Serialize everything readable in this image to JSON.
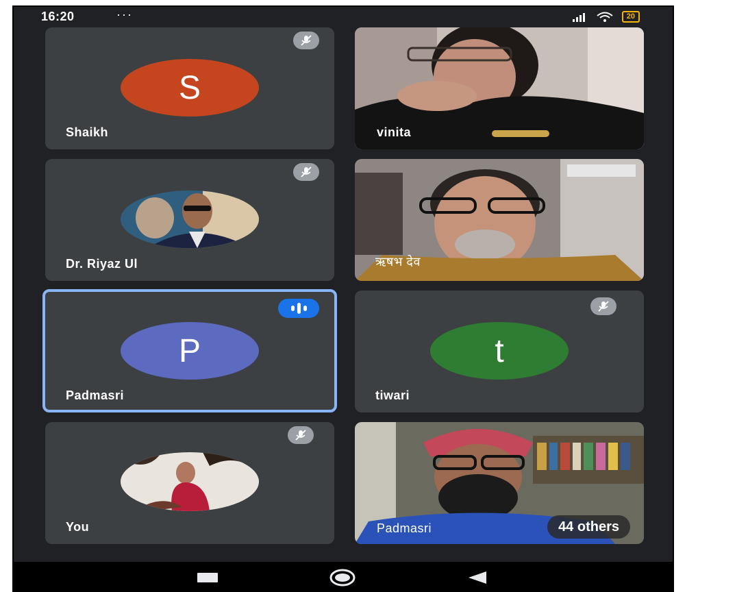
{
  "status_bar": {
    "time": "16:20",
    "more": "···",
    "signal": "signal-icon",
    "wifi": "wifi-icon",
    "battery": "20"
  },
  "tiles": [
    {
      "name": "Shaikh",
      "initial": "S",
      "color": "#c5451f",
      "muted": true
    },
    {
      "name": "vinita",
      "type": "video",
      "muted": false
    },
    {
      "name": "Dr. Riyaz Ul",
      "type": "photo-avatar",
      "muted": true
    },
    {
      "name": "ऋषभ देव",
      "type": "video",
      "muted": false
    },
    {
      "name": "Padmasri",
      "initial": "P",
      "color": "#5c6bc0",
      "speaking": true
    },
    {
      "name": "tiwari",
      "initial": "t",
      "color": "#2e7d32",
      "muted": true
    },
    {
      "name": "You",
      "type": "photo-avatar",
      "muted": true
    },
    {
      "name": "Padmasri",
      "type": "video",
      "others_label": "44 others"
    }
  ],
  "icons": {
    "mute": "mic-off-icon",
    "speaking": "audio-level-icon"
  },
  "nav": [
    "recent-apps-icon",
    "home-icon",
    "back-icon"
  ]
}
